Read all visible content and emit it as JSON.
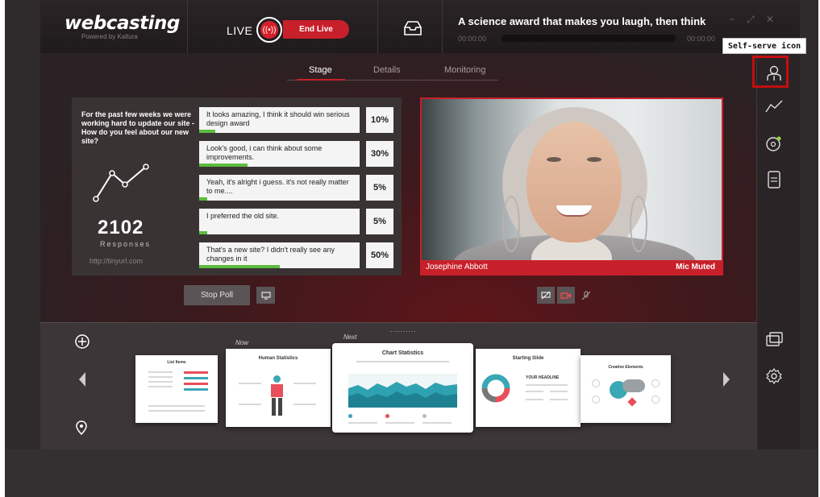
{
  "header": {
    "logo_text": "webcasting",
    "logo_sub": "Powered by Kaltura",
    "live_label": "LIVE",
    "end_live_label": "End Live",
    "event_title": "A science award that makes you laugh, then think",
    "time_start": "00:00:00",
    "time_end": "00:00:00",
    "window_controls": [
      "−",
      "⤢",
      "✕"
    ]
  },
  "tooltip": "Self-serve icon",
  "tabs": [
    {
      "label": "Stage",
      "active": true
    },
    {
      "label": "Details",
      "active": false
    },
    {
      "label": "Monitoring",
      "active": false
    }
  ],
  "poll": {
    "question": "For the past few weeks we were working hard to update our site - How do you feel about our new site?",
    "responses_count": "2102",
    "responses_label": "Responses",
    "url": "http://tinyurl.com",
    "answers": [
      {
        "text": "It looks amazing, I think it should win serious design award",
        "percent": "10%"
      },
      {
        "text": "Look's good, i can think about some improvements.",
        "percent": "30%"
      },
      {
        "text": "Yeah, it's alright i guess. it's not really matter to me....",
        "percent": "5%"
      },
      {
        "text": "I preferred the old site.",
        "percent": "5%"
      },
      {
        "text": "That's a new site? I didn't really see any changes in it",
        "percent": "50%"
      }
    ],
    "stop_poll_label": "Stop Poll"
  },
  "video": {
    "presenter_name": "Josephine Abbott",
    "mic_status": "Mic Muted"
  },
  "slides": {
    "now_label": "Now",
    "next_label": "Next",
    "dots": "..........",
    "items": [
      {
        "title": "List Items"
      },
      {
        "title": "Human Statistics"
      },
      {
        "title": "Chart Statistics"
      },
      {
        "title": "Starting Slide",
        "headline": "YOUR HEADLINE"
      },
      {
        "title": "Creative Elements"
      }
    ]
  },
  "colors": {
    "accent": "#c8202a",
    "progress_green": "#5dbb3f",
    "highlight_box": "#c40e0e"
  }
}
